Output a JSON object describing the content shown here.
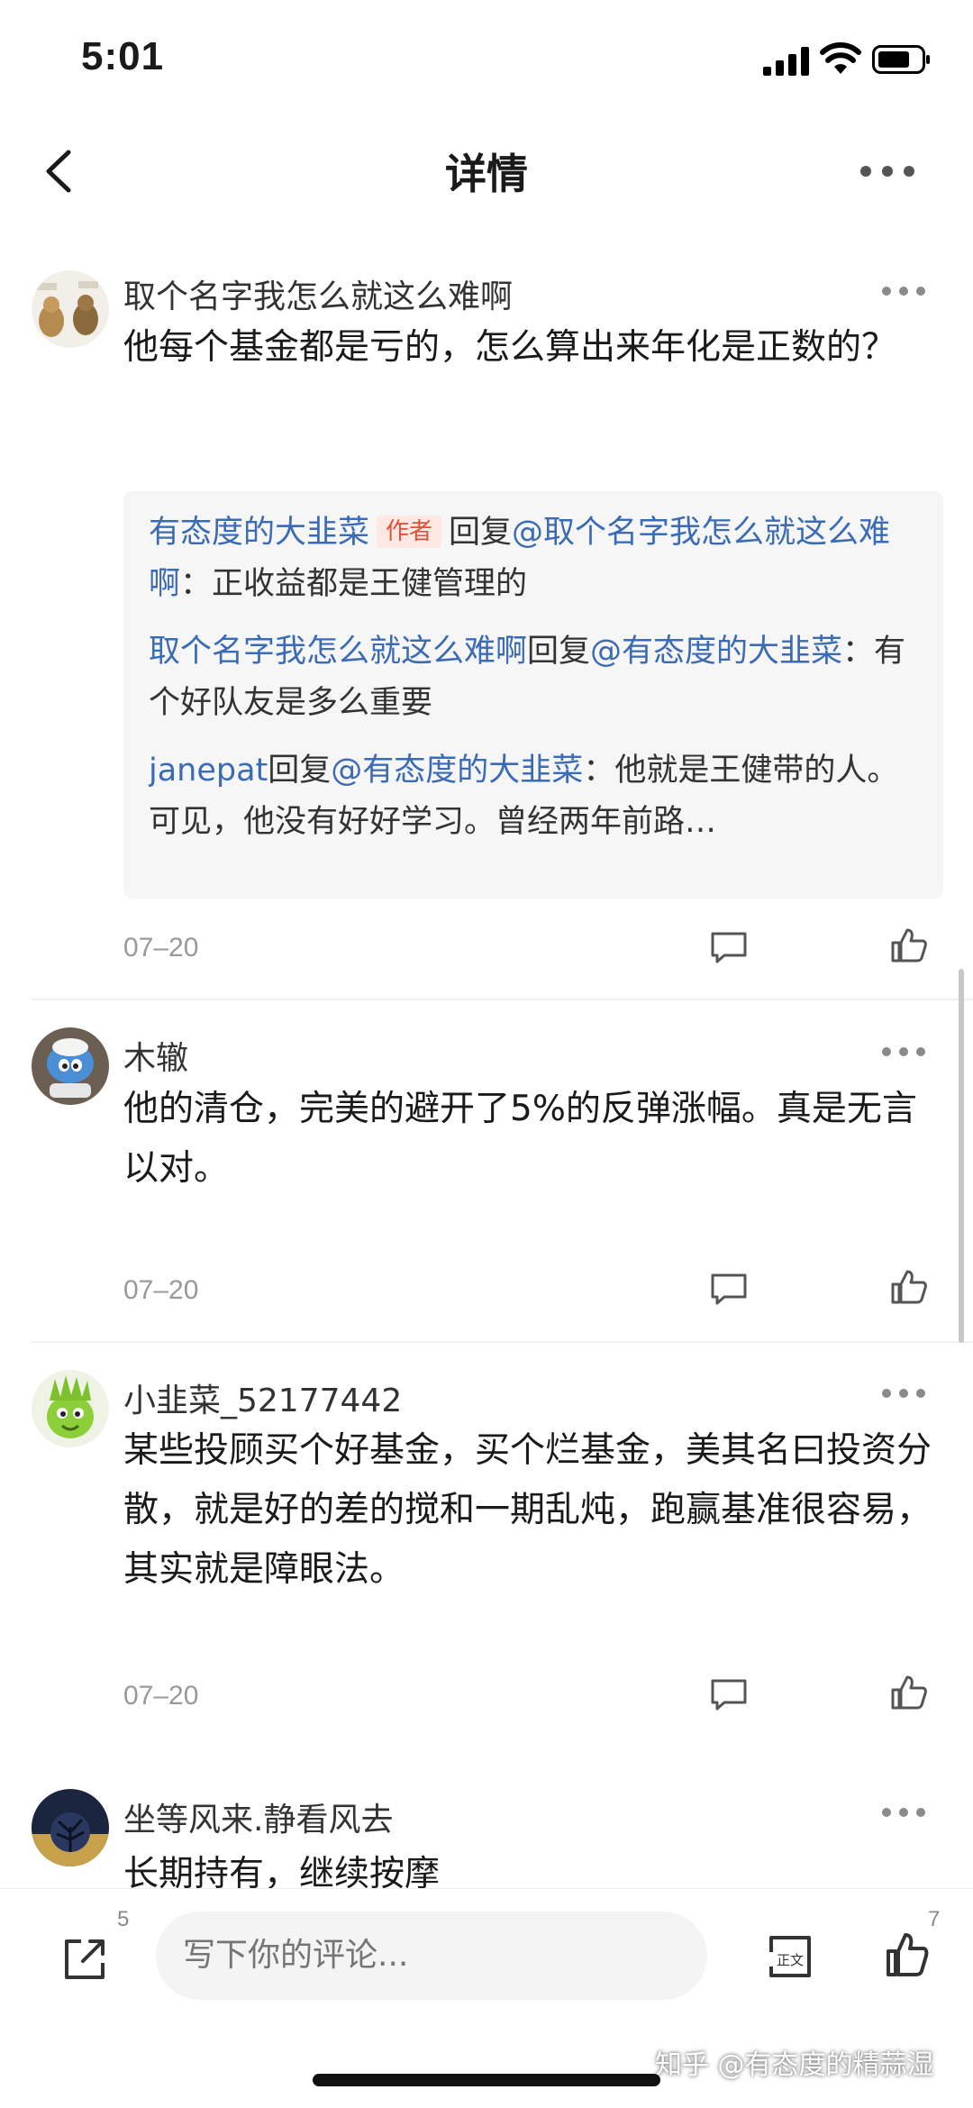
{
  "status_bar": {
    "time": "5:01"
  },
  "nav": {
    "title": "详情"
  },
  "comments": [
    {
      "name": "取个名字我怎么就这么难啊",
      "body": "他每个基金都是亏的，怎么算出来年化是正数的？",
      "date": "07–20",
      "replies": [
        {
          "user": "有态度的大韭菜",
          "tag": "作者",
          "verb": "回复",
          "target": "@取个名字我怎么就这么难啊",
          "text": "：正收益都是王健管理的"
        },
        {
          "user": "取个名字我怎么就这么难啊",
          "verb": "回复",
          "target": "@有态度的大韭菜",
          "text": "：有个好队友是多么重要"
        },
        {
          "user": "janepat",
          "verb": "回复",
          "target": "@有态度的大韭菜",
          "text": "：他就是王健带的人。可见，他没有好好学习。曾经两年前路…"
        }
      ]
    },
    {
      "name": "木辙",
      "body": "他的清仓，完美的避开了5%的反弹涨幅。真是无言以对。",
      "date": "07–20"
    },
    {
      "name": "小韭菜_52177442",
      "body": "某些投顾买个好基金，买个烂基金，美其名曰投资分散，就是好的差的搅和一期乱炖，跑赢基准很容易，其实就是障眼法。",
      "date": "07–20"
    },
    {
      "name": "坐等风来.静看风去",
      "body": "长期持有，继续按摩"
    }
  ],
  "bottom_bar": {
    "share_count": "5",
    "input_placeholder": "写下你的评论...",
    "article_label": "正文",
    "like_count": "7",
    "watermark": "知乎 @有态度的精蒜湿"
  },
  "icons": [
    "back-icon",
    "more-icon",
    "reply-icon",
    "like-icon",
    "share-icon",
    "article-icon"
  ],
  "colors": {
    "link": "#3b6bb5",
    "author_tag": "#e0503a",
    "reply_bg": "#f6f6f6"
  }
}
